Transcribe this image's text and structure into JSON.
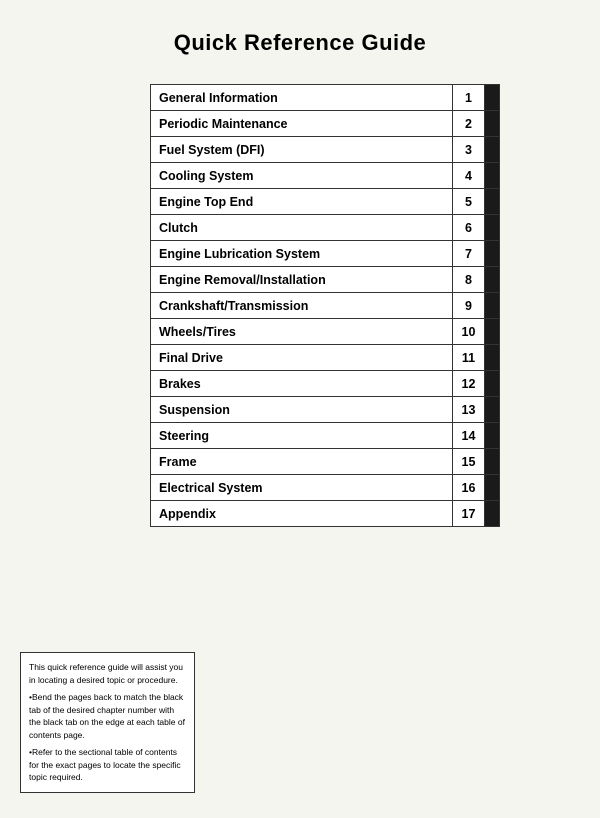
{
  "page": {
    "title": "Quick Reference Guide",
    "toc": [
      {
        "label": "General Information",
        "number": "1"
      },
      {
        "label": "Periodic Maintenance",
        "number": "2"
      },
      {
        "label": "Fuel System (DFI)",
        "number": "3"
      },
      {
        "label": "Cooling System",
        "number": "4"
      },
      {
        "label": "Engine Top End",
        "number": "5"
      },
      {
        "label": "Clutch",
        "number": "6"
      },
      {
        "label": "Engine Lubrication System",
        "number": "7"
      },
      {
        "label": "Engine Removal/Installation",
        "number": "8"
      },
      {
        "label": "Crankshaft/Transmission",
        "number": "9"
      },
      {
        "label": "Wheels/Tires",
        "number": "10"
      },
      {
        "label": "Final Drive",
        "number": "11"
      },
      {
        "label": "Brakes",
        "number": "12"
      },
      {
        "label": "Suspension",
        "number": "13"
      },
      {
        "label": "Steering",
        "number": "14"
      },
      {
        "label": "Frame",
        "number": "15"
      },
      {
        "label": "Electrical System",
        "number": "16"
      },
      {
        "label": "Appendix",
        "number": "17"
      }
    ],
    "note": {
      "line1": "This quick reference guide will assist you in locating a desired topic or procedure.",
      "line2": "•Bend the pages back to match the black tab of the desired chapter number with the black tab on the edge at each table of contents page.",
      "line3": "•Refer to the sectional table of contents for the exact pages to locate the specific topic required."
    }
  }
}
